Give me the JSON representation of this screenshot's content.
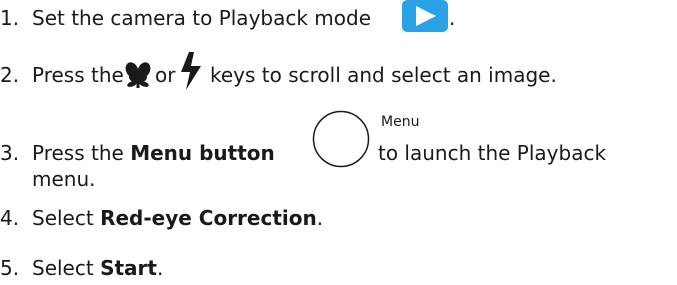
{
  "steps": [
    {
      "num": "1.",
      "text": "Set the camera to Playback mode",
      "after": "."
    },
    {
      "num": "2.",
      "pre": "Press the",
      "mid": "or",
      "post": "keys to scroll and select an image."
    },
    {
      "num": "3.",
      "pre": "Press the",
      "bold": "Menu button",
      "post": "to launch the Playback",
      "cont": "menu.",
      "button_label": "Menu"
    },
    {
      "num": "4.",
      "pre": "Select",
      "bold": "Red-eye Correction",
      "post": "."
    },
    {
      "num": "5.",
      "pre": "Select",
      "bold": "Start",
      "post": "."
    }
  ],
  "icons": {
    "playback": "playback-icon",
    "macro": "macro-flower-icon",
    "flash": "flash-icon",
    "menu": "menu-button-icon"
  },
  "colors": {
    "playback_blue": "#2aa3e6",
    "text": "#1a1a1a"
  }
}
